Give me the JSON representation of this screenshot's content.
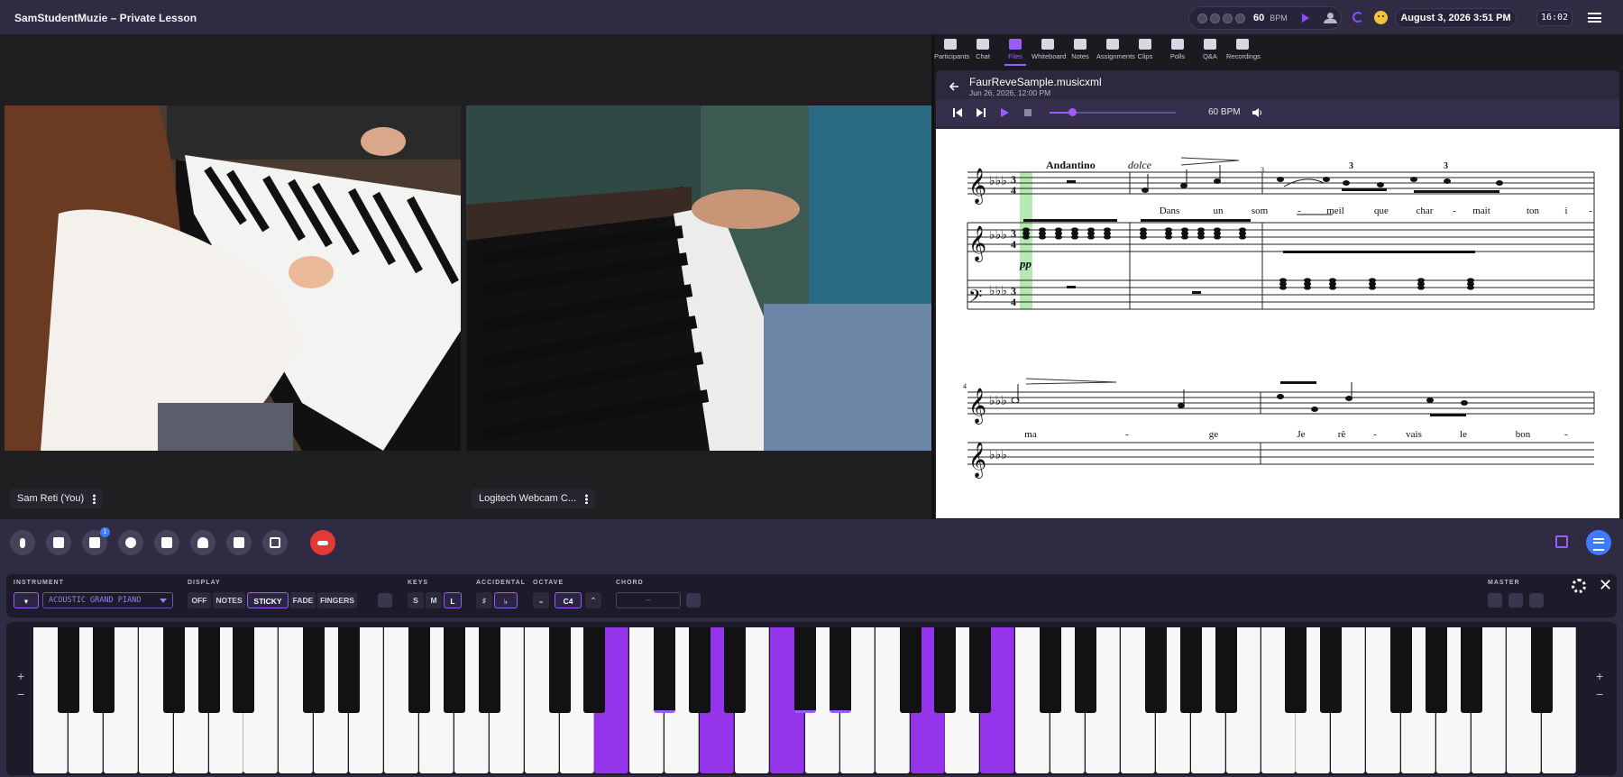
{
  "app": {
    "title": "SamStudentMuzie – Private Lesson"
  },
  "header": {
    "metronome_bpm": "60",
    "metronome_unit": "BPM",
    "datetime": "August 3, 2026 3:51 PM",
    "clock": "16:02"
  },
  "videos": {
    "local_label": "Sam Reti (You)",
    "remote_label": "Logitech Webcam C..."
  },
  "panel": {
    "tabs": [
      {
        "label": "Participants",
        "icon": "participants-icon"
      },
      {
        "label": "Chat",
        "icon": "chat-icon"
      },
      {
        "label": "Files",
        "icon": "folder-icon"
      },
      {
        "label": "Whiteboard",
        "icon": "whiteboard-icon"
      },
      {
        "label": "Notes",
        "icon": "notes-icon"
      },
      {
        "label": "Assignments",
        "icon": "assignments-icon"
      },
      {
        "label": "Clips",
        "icon": "clips-icon"
      },
      {
        "label": "Polls",
        "icon": "polls-icon"
      },
      {
        "label": "Q&A",
        "icon": "qa-icon"
      },
      {
        "label": "Recordings",
        "icon": "recordings-icon"
      }
    ],
    "active_tab": "Files",
    "file_name": "FaurReveSample.musicxml",
    "file_date": "Jun 26, 2026, 12:00 PM",
    "player_bpm": "60 BPM",
    "player_progress": 0.18
  },
  "score": {
    "tempo": "Andantino",
    "expression": "dolce",
    "dynamic": "pp",
    "triplet": "3",
    "measure_start_1": "3",
    "measure_start_2": "4",
    "lyrics_line1": [
      "Dans",
      "un",
      "som",
      "-",
      "meil",
      "que",
      "char",
      "-",
      "mait",
      "ton",
      "i",
      "-"
    ],
    "lyrics_line2": [
      "ma",
      "-",
      "ge",
      "Je",
      "rê",
      "-",
      "vais",
      "le",
      "bon",
      "-"
    ]
  },
  "controls": {
    "camera_badge": "1"
  },
  "piano_settings": {
    "instrument_label": "INSTRUMENT",
    "instrument_value": "ACOUSTIC GRAND PIANO",
    "display_label": "DISPLAY",
    "display_options": [
      "OFF",
      "NOTES",
      "STICKY",
      "FADE",
      "FINGERS"
    ],
    "display_selected": "STICKY",
    "keys_label": "KEYS",
    "keys_options": [
      "S",
      "M",
      "L"
    ],
    "keys_selected": "L",
    "accidental_label": "ACCIDENTAL",
    "accidental_options": [
      "♯",
      "♭"
    ],
    "accidental_selected": "♭",
    "octave_label": "OCTAVE",
    "octave_value": "C4",
    "chord_label": "CHORD",
    "chord_value": "--",
    "master_label": "MASTER"
  },
  "keyboard": {
    "side_plus": "+",
    "side_minus": "−",
    "white_keys_total": 44,
    "active_white_keys": [
      16,
      19,
      21,
      25,
      27
    ],
    "active_black_keys": [
      16,
      17,
      20,
      21,
      22
    ]
  },
  "colors": {
    "accent": "#9b5cff",
    "key_highlight": "#9333ea",
    "header_bg": "#2e2b43",
    "end_call": "#e53935"
  }
}
